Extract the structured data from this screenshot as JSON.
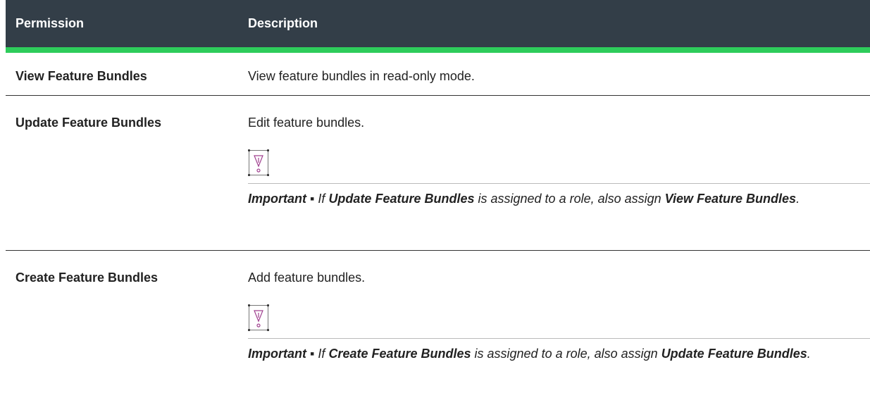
{
  "header": {
    "permission": "Permission",
    "description": "Description"
  },
  "rows": [
    {
      "permission": "View Feature Bundles",
      "description": "View feature bundles in read-only mode."
    },
    {
      "permission": "Update Feature Bundles",
      "description": "Edit feature bundles.",
      "icon": "important-icon",
      "note": {
        "label": "Important ▪",
        "pre": "If",
        "bold1": "Update Feature Bundles",
        "mid": "is assigned to a role, also assign",
        "bold2": "View Feature Bundles",
        "end": "."
      }
    },
    {
      "permission": "Create Feature Bundles",
      "description": "Add feature bundles.",
      "icon": "important-icon",
      "note": {
        "label": "Important ▪",
        "pre": "If",
        "bold1": "Create Feature Bundles",
        "mid": "is assigned to a role, also assign",
        "bold2": "Update Feature Bundles",
        "end": "."
      }
    }
  ],
  "colors": {
    "header_bg": "#333e48",
    "header_accent": "#2ecc5b",
    "icon": "#a0408f"
  }
}
